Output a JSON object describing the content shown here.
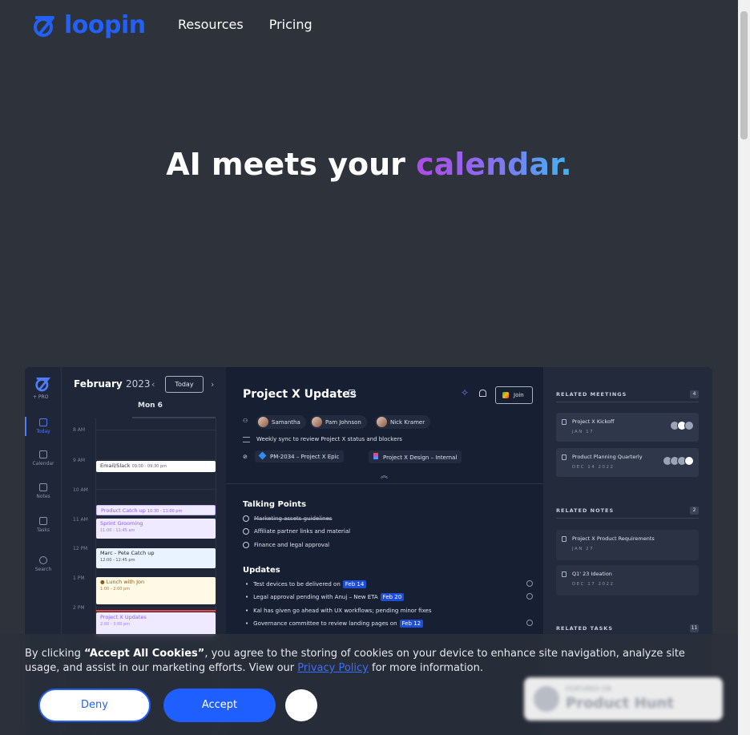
{
  "header": {
    "logo_text": "loopin",
    "nav": [
      "Resources",
      "Pricing"
    ]
  },
  "hero": {
    "title_plain": "AI meets your ",
    "title_highlight": "calendar."
  },
  "app": {
    "sidebar": {
      "pro_label": "+ PRO",
      "items": [
        "Today",
        "Calendar",
        "Notes",
        "Tasks",
        "Search"
      ]
    },
    "calendar": {
      "month": "February",
      "year": "2023",
      "today_button": "Today",
      "day_label": "Mon 6",
      "times": [
        "8 AM",
        "9 AM",
        "10 AM",
        "11 AM",
        "12 PM",
        "1 PM",
        "2 PM"
      ],
      "events": [
        {
          "title": "Email/Slack",
          "time": "09:00 - 09:30 pm"
        },
        {
          "title": "Product Catch up",
          "time": "10:30 - 11:00 pm"
        },
        {
          "title": "Sprint Grooming",
          "time": "11:00 - 11:45 am"
        },
        {
          "title": "Marc - Pete Catch up",
          "time": "12:00 - 12:45 pm"
        },
        {
          "title": "Lunch with Jon",
          "time": "1:00 - 2:00 pm"
        },
        {
          "title": "Project X Updates",
          "time": "2:00 - 3:00 pm"
        }
      ]
    },
    "detail": {
      "title": "Project X Updates",
      "join_label": "Join",
      "attendees": [
        "Samantha",
        "Pam Johnson",
        "Nick Kramer"
      ],
      "description": "Weekly sync to review Project X status and blockers",
      "links": [
        "PM-2034 – Project X Epic",
        "Project X Design – Internal"
      ],
      "talking_points_heading": "Talking Points",
      "talking_points": [
        "Marketing assets guidelines",
        "Affiliate partner links and material",
        "Finance and legal approval"
      ],
      "updates_heading": "Updates",
      "updates": [
        {
          "text": "Test devices to be delivered on",
          "tag": "Feb 14"
        },
        {
          "text": "Legal approval pending with Anuj – New ETA",
          "tag": "Feb 20"
        },
        {
          "text": "Kal has given go ahead with UX workflows; pending minor fixes",
          "tag": ""
        },
        {
          "text": "Governance committee to review landing pages on",
          "tag": "Feb 12"
        }
      ]
    },
    "related": {
      "meetings_heading": "RELATED MEETINGS",
      "meetings_count": "4",
      "meetings": [
        {
          "name": "Project X Kickoff",
          "date": "JAN 17"
        },
        {
          "name": "Product Planning Quarterly",
          "date": "DEC 14 2022"
        }
      ],
      "notes_heading": "RELATED NOTES",
      "notes_count": "2",
      "notes": [
        {
          "name": "Project X Product Requirements",
          "date": "JAN 27"
        },
        {
          "name": "Q1' 23 Ideation",
          "date": "DEC 17 2022"
        }
      ],
      "tasks_heading": "RELATED TASKS",
      "tasks_count": "11"
    }
  },
  "cookie": {
    "text_start": "By clicking ",
    "text_bold": "“Accept All Cookies”",
    "text_mid": ", you agree to the storing of cookies on your device to enhance site navigation, analyze site usage, and assist in our marketing efforts. View our ",
    "link": "Privacy Policy",
    "text_end": " for more information.",
    "deny": "Deny",
    "accept": "Accept"
  },
  "badge": {
    "small": "FEATURED ON",
    "big": "Product Hunt"
  },
  "colors": {
    "brand": "#2360f5",
    "accept": "#1f5eff",
    "page_bg": "#2d323b"
  }
}
